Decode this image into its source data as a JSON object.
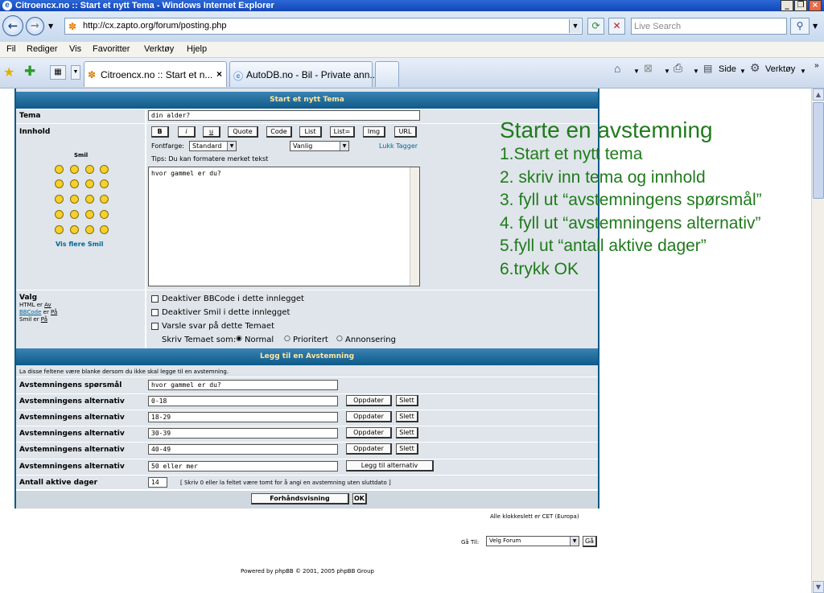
{
  "window": {
    "title": "Citroencx.no :: Start et nytt Tema - Windows Internet Explorer"
  },
  "browser": {
    "url": "http://cx.zapto.org/forum/posting.php",
    "search_placeholder": "Live Search",
    "menu": [
      "Fil",
      "Rediger",
      "Vis",
      "Favoritter",
      "Verktøy",
      "Hjelp"
    ],
    "tabs": [
      {
        "label": "Citroencx.no :: Start et n..."
      },
      {
        "label": "AutoDB.no - Bil - Private ann..."
      }
    ],
    "toolbar": {
      "side": "Side",
      "verktoy": "Verktøy"
    }
  },
  "form": {
    "header": "Start et nytt Tema",
    "tema_label": "Tema",
    "tema_value": "din alder?",
    "innhold_label": "Innhold",
    "format_buttons": [
      "B",
      "i",
      "u",
      "Quote",
      "Code",
      "List",
      "List=",
      "Img",
      "URL"
    ],
    "fontfarge_label": "Fontfarge:",
    "fontfarge_value": "Standard",
    "size_value": "Vanlig",
    "lukk_tagger": "Lukk Tagger",
    "tips": "Tips: Du kan formatere merket tekst",
    "smil_label": "Smil",
    "vis_flere": "Vis flere Smil",
    "message": "hvor gammel er du?",
    "valg_label": "Valg",
    "valg_info": [
      [
        "HTML er ",
        "Av"
      ],
      [
        "BBCode",
        " er ",
        "På"
      ],
      [
        "Smil er ",
        "På"
      ]
    ],
    "options": [
      "Deaktiver BBCode i dette innlegget",
      "Deaktiver Smil i dette innlegget",
      "Varsle svar på dette Temaet"
    ],
    "skriv_som": "Skriv Temaet som:",
    "post_types": [
      "Normal",
      "Prioritert",
      "Annonsering"
    ]
  },
  "poll": {
    "header": "Legg til en Avstemning",
    "note": "La disse feltene være blanke dersom du ikke skal legge til en avstemning.",
    "question_label": "Avstemningens spørsmål",
    "question_value": "hvor gammel er du?",
    "alt_label": "Avstemningens alternativ",
    "alternatives": [
      "0-18",
      "18-29",
      "30-39",
      "40-49"
    ],
    "new_alt_value": "50 eller mer",
    "update_btn": "Oppdater",
    "delete_btn": "Slett",
    "add_btn": "Legg til alternativ",
    "days_label": "Antall aktive dager",
    "days_value": "14",
    "days_hint": "[ Skriv 0 eller la feltet være tomt for å angi en avstemning uten sluttdato ]",
    "preview_btn": "Forhåndsvisning",
    "ok_btn": "OK"
  },
  "footer": {
    "timezone": "Alle klokkeslett er CET (Europa)",
    "goto_label": "Gå Til:",
    "goto_value": "Velg Forum",
    "goto_btn": "Gå",
    "powered": "Powered by phpBB © 2001, 2005 phpBB Group"
  },
  "overlay": {
    "title": "Starte en avstemning",
    "steps": [
      "1.Start et nytt tema",
      "2. skriv inn tema og innhold",
      "3. fyll ut “avstemningens spørsmål”",
      "4. fyll ut “avstemningens alternativ”",
      "5.fyll ut “antall aktive dager”",
      "6.trykk OK"
    ]
  }
}
